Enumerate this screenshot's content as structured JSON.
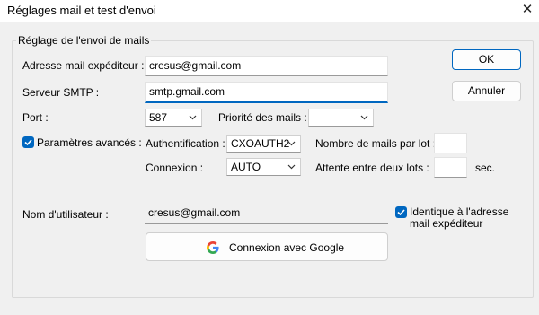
{
  "window": {
    "title": "Réglages mail et test d'envoi",
    "close_glyph": "✕"
  },
  "group": {
    "title": "Réglage de l'envoi de mails"
  },
  "sender": {
    "label": "Adresse mail expéditeur :",
    "value": "cresus@gmail.com"
  },
  "smtp": {
    "label": "Serveur SMTP :",
    "value": "smtp.gmail.com"
  },
  "port": {
    "label": "Port :",
    "value": "587"
  },
  "priority": {
    "label": "Priorité des mails :",
    "value": ""
  },
  "advanced": {
    "label": "Paramètres avancés :",
    "checked": true
  },
  "auth": {
    "label": "Authentification :",
    "value": "CXOAUTH2"
  },
  "connection": {
    "label": "Connexion :",
    "value": "AUTO"
  },
  "batch": {
    "label": "Nombre de mails par lot :",
    "value": ""
  },
  "wait": {
    "label": "Attente entre deux lots :",
    "value": "",
    "unit": "sec."
  },
  "username": {
    "label": "Nom d'utilisateur :",
    "value": "cresus@gmail.com"
  },
  "same_as_sender": {
    "label_line1": "Identique à l'adresse",
    "label_line2": "mail expéditeur",
    "checked": true
  },
  "buttons": {
    "ok": "OK",
    "cancel": "Annuler",
    "google": "Connexion avec Google"
  },
  "icons": {
    "chevron": "chevron-down-icon",
    "check": "check-icon",
    "google": "google-logo-icon",
    "close": "close-icon"
  },
  "colors": {
    "accent": "#0067c0",
    "google_blue": "#4285F4",
    "google_red": "#EA4335",
    "google_yellow": "#FBBC05",
    "google_green": "#34A853"
  }
}
